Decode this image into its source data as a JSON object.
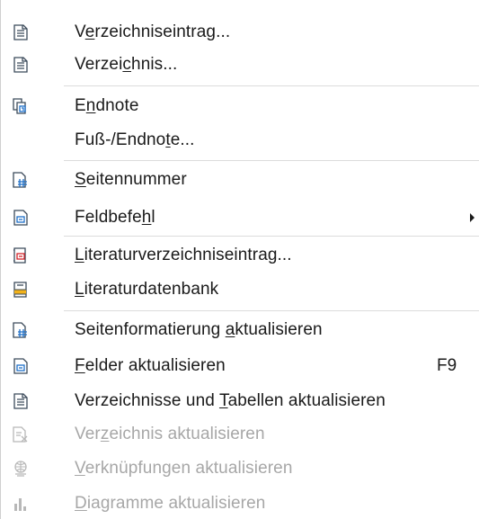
{
  "menu": {
    "items": [
      {
        "pre": "V",
        "u": "e",
        "post": "rzeichniseintrag...",
        "icon": "document-index-icon"
      },
      {
        "pre": "Verzei",
        "u": "c",
        "post": "hnis...",
        "icon": "document-index-icon"
      },
      {
        "pre": "E",
        "u": "n",
        "post": "dnote",
        "icon": "endnote-icon"
      },
      {
        "pre": "Fuß-/Endno",
        "u": "t",
        "post": "e...",
        "icon": ""
      },
      {
        "pre": "",
        "u": "S",
        "post": "eitennummer",
        "icon": "page-number-icon"
      },
      {
        "pre": "Feldbefe",
        "u": "h",
        "post": "l",
        "icon": "field-icon",
        "submenu": true
      },
      {
        "pre": "",
        "u": "L",
        "post": "iteraturverzeichniseintrag...",
        "icon": "bibliography-entry-icon"
      },
      {
        "pre": "",
        "u": "L",
        "post": "iteraturdatenbank",
        "icon": "bibliography-database-icon"
      },
      {
        "pre": "Seitenformatierung ",
        "u": "a",
        "post": "ktualisieren",
        "icon": "page-number-icon"
      },
      {
        "pre": "",
        "u": "F",
        "post": "elder aktualisieren",
        "icon": "field-icon",
        "shortcut": "F9"
      },
      {
        "pre": "Verzeichnisse und ",
        "u": "T",
        "post": "abellen aktualisieren",
        "icon": "document-index-icon"
      },
      {
        "pre": "Ver",
        "u": "z",
        "post": "eichnis aktualisieren",
        "icon": "update-index-icon",
        "disabled": true
      },
      {
        "pre": "",
        "u": "V",
        "post": "erknüpfungen aktualisieren",
        "icon": "update-links-icon",
        "disabled": true
      },
      {
        "pre": "",
        "u": "D",
        "post": "iagramme aktualisieren",
        "icon": "update-charts-icon",
        "disabled": true
      }
    ],
    "shortcut_f9": "F9"
  }
}
